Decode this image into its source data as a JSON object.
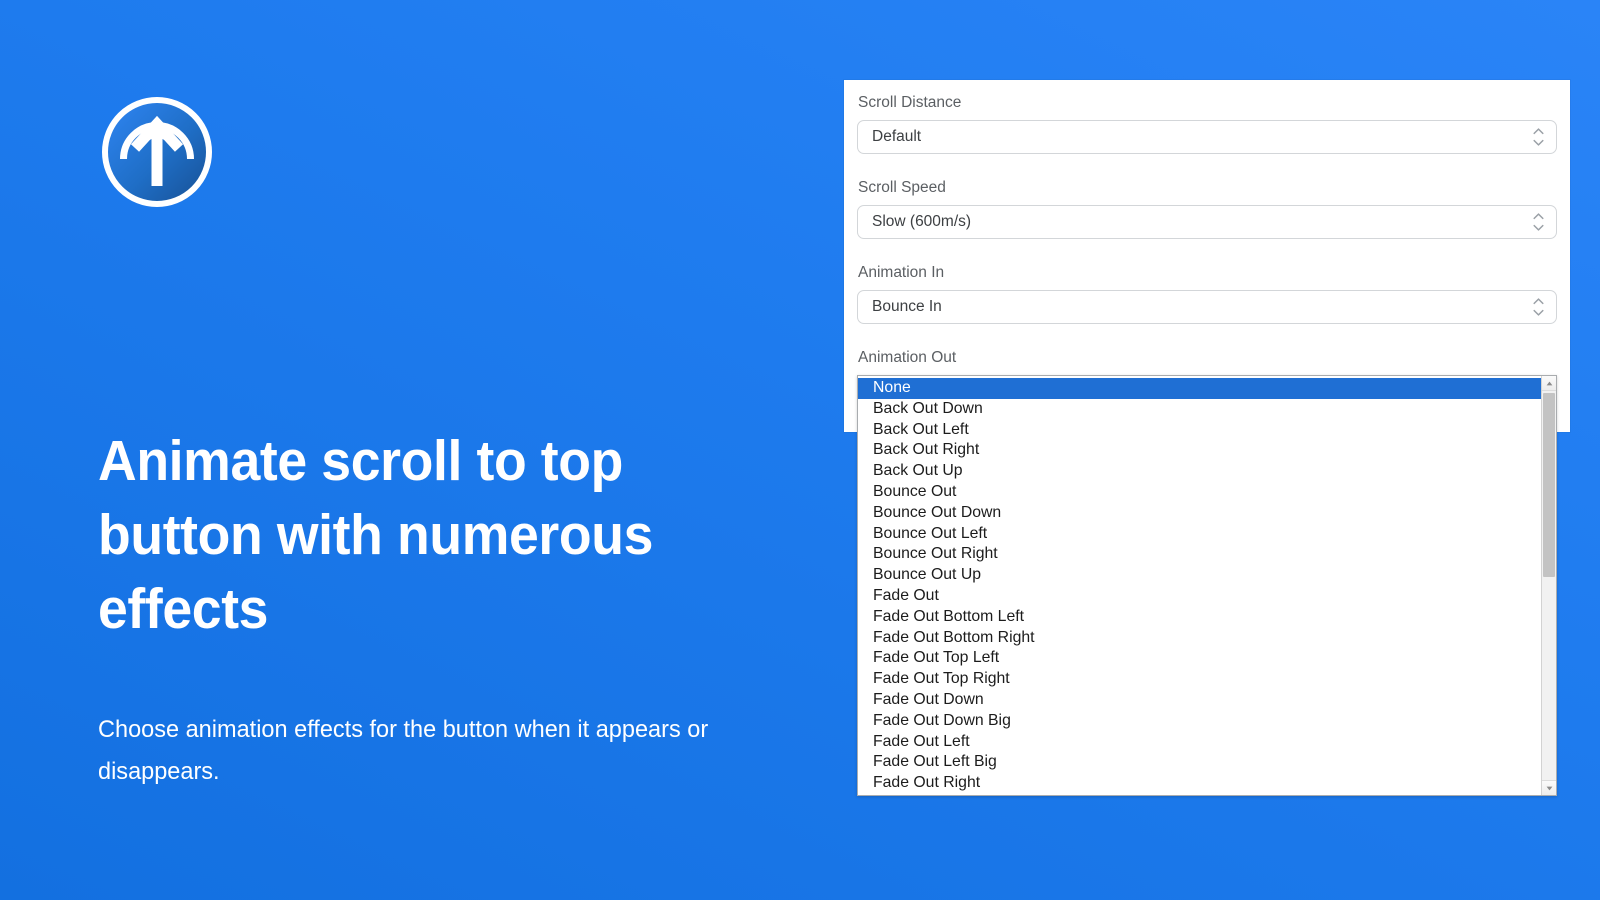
{
  "theme": {
    "brand_blue": "#1f7cef",
    "brand_blue_light": "#2a84f7",
    "brand_blue_dark": "#1370e0",
    "selection_blue": "#1f6fd4",
    "card_background": "#ffffff",
    "label_gray": "#5b5f63",
    "value_gray": "#3d4043"
  },
  "hero": {
    "logo_name": "scroll-to-top-logo",
    "headline": "Animate scroll to top button with numerous effects",
    "subhead": "Choose animation effects for the button when it appears or disappears."
  },
  "settings": {
    "fields": [
      {
        "label": "Scroll Distance",
        "value": "Default",
        "name": "scroll-distance",
        "stepper_icon": "stepper-chevrons-icon"
      },
      {
        "label": "Scroll Speed",
        "value": "Slow (600m/s)",
        "name": "scroll-speed",
        "stepper_icon": "stepper-chevrons-icon"
      },
      {
        "label": "Animation In",
        "value": "Bounce In",
        "name": "animation-in",
        "stepper_icon": "stepper-chevrons-icon"
      },
      {
        "label": "Animation Out",
        "value": "None",
        "name": "animation-out",
        "stepper_icon": "stepper-chevrons-icon"
      }
    ]
  },
  "dropdown": {
    "name": "animation-out-listbox",
    "selected_index": 0,
    "selected_value": "None",
    "scrollbar": {
      "up_arrow_icon": "scroll-up-arrow-icon",
      "down_arrow_icon": "scroll-down-arrow-icon",
      "thumb_name": "scrollbar-thumb"
    },
    "options": [
      "None",
      "Back Out Down",
      "Back Out Left",
      "Back Out Right",
      "Back Out Up",
      "Bounce Out",
      "Bounce Out Down",
      "Bounce Out Left",
      "Bounce Out Right",
      "Bounce Out Up",
      "Fade Out",
      "Fade Out Bottom Left",
      "Fade Out Bottom Right",
      "Fade Out Top Left",
      "Fade Out Top Right",
      "Fade Out Down",
      "Fade Out Down Big",
      "Fade Out Left",
      "Fade Out Left Big",
      "Fade Out Right"
    ]
  }
}
